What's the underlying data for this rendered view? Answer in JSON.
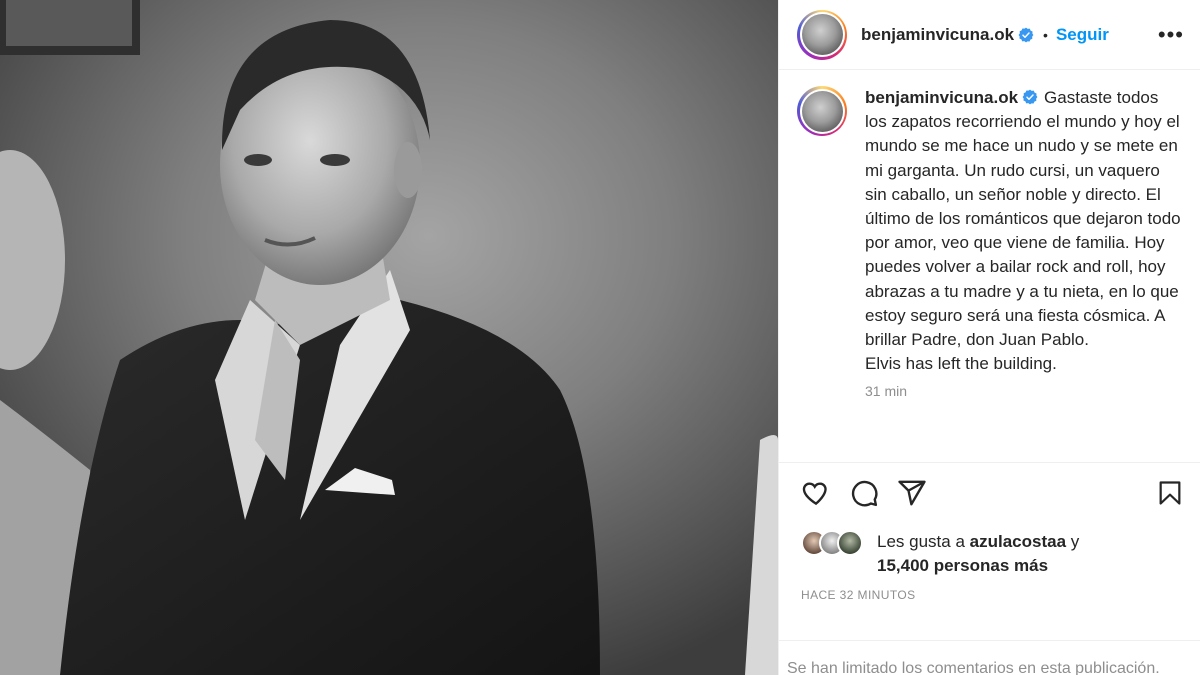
{
  "post": {
    "username": "benjaminvicuna.ok",
    "verified": true,
    "follow_label": "Seguir",
    "more_label": "•••",
    "dot_separator": "•",
    "caption": "Gastaste todos los zapatos recorriendo el mundo y hoy el mundo se me hace un nudo y se mete en mi garganta. Un rudo cursi, un vaquero sin caballo, un señor noble y directo. El último de los románticos que dejaron todo por amor, veo que viene de familia. Hoy puedes volver a bailar rock and roll, hoy abrazas a tu madre y a tu nieta, en lo que estoy seguro será una fiesta cósmica. A brillar Padre, don Juan Pablo.\nElvis has left the building.",
    "caption_time": "31 min",
    "likes_prefix": "Les gusta a",
    "likes_user": "azulacostaa",
    "likes_conj": "y",
    "likes_count": "15,400 personas más",
    "timestamp": "HACE 32 MINUTOS",
    "comments_limited": "Se han limitado los comentarios en esta publicación."
  },
  "icons": {
    "like": "heart-icon",
    "comment": "comment-icon",
    "share": "share-icon",
    "save": "bookmark-icon",
    "verified": "verified-badge-icon"
  },
  "colors": {
    "accent": "#0095f6",
    "text": "#262626",
    "muted": "#8e8e8e",
    "verified": "#3897f0"
  }
}
